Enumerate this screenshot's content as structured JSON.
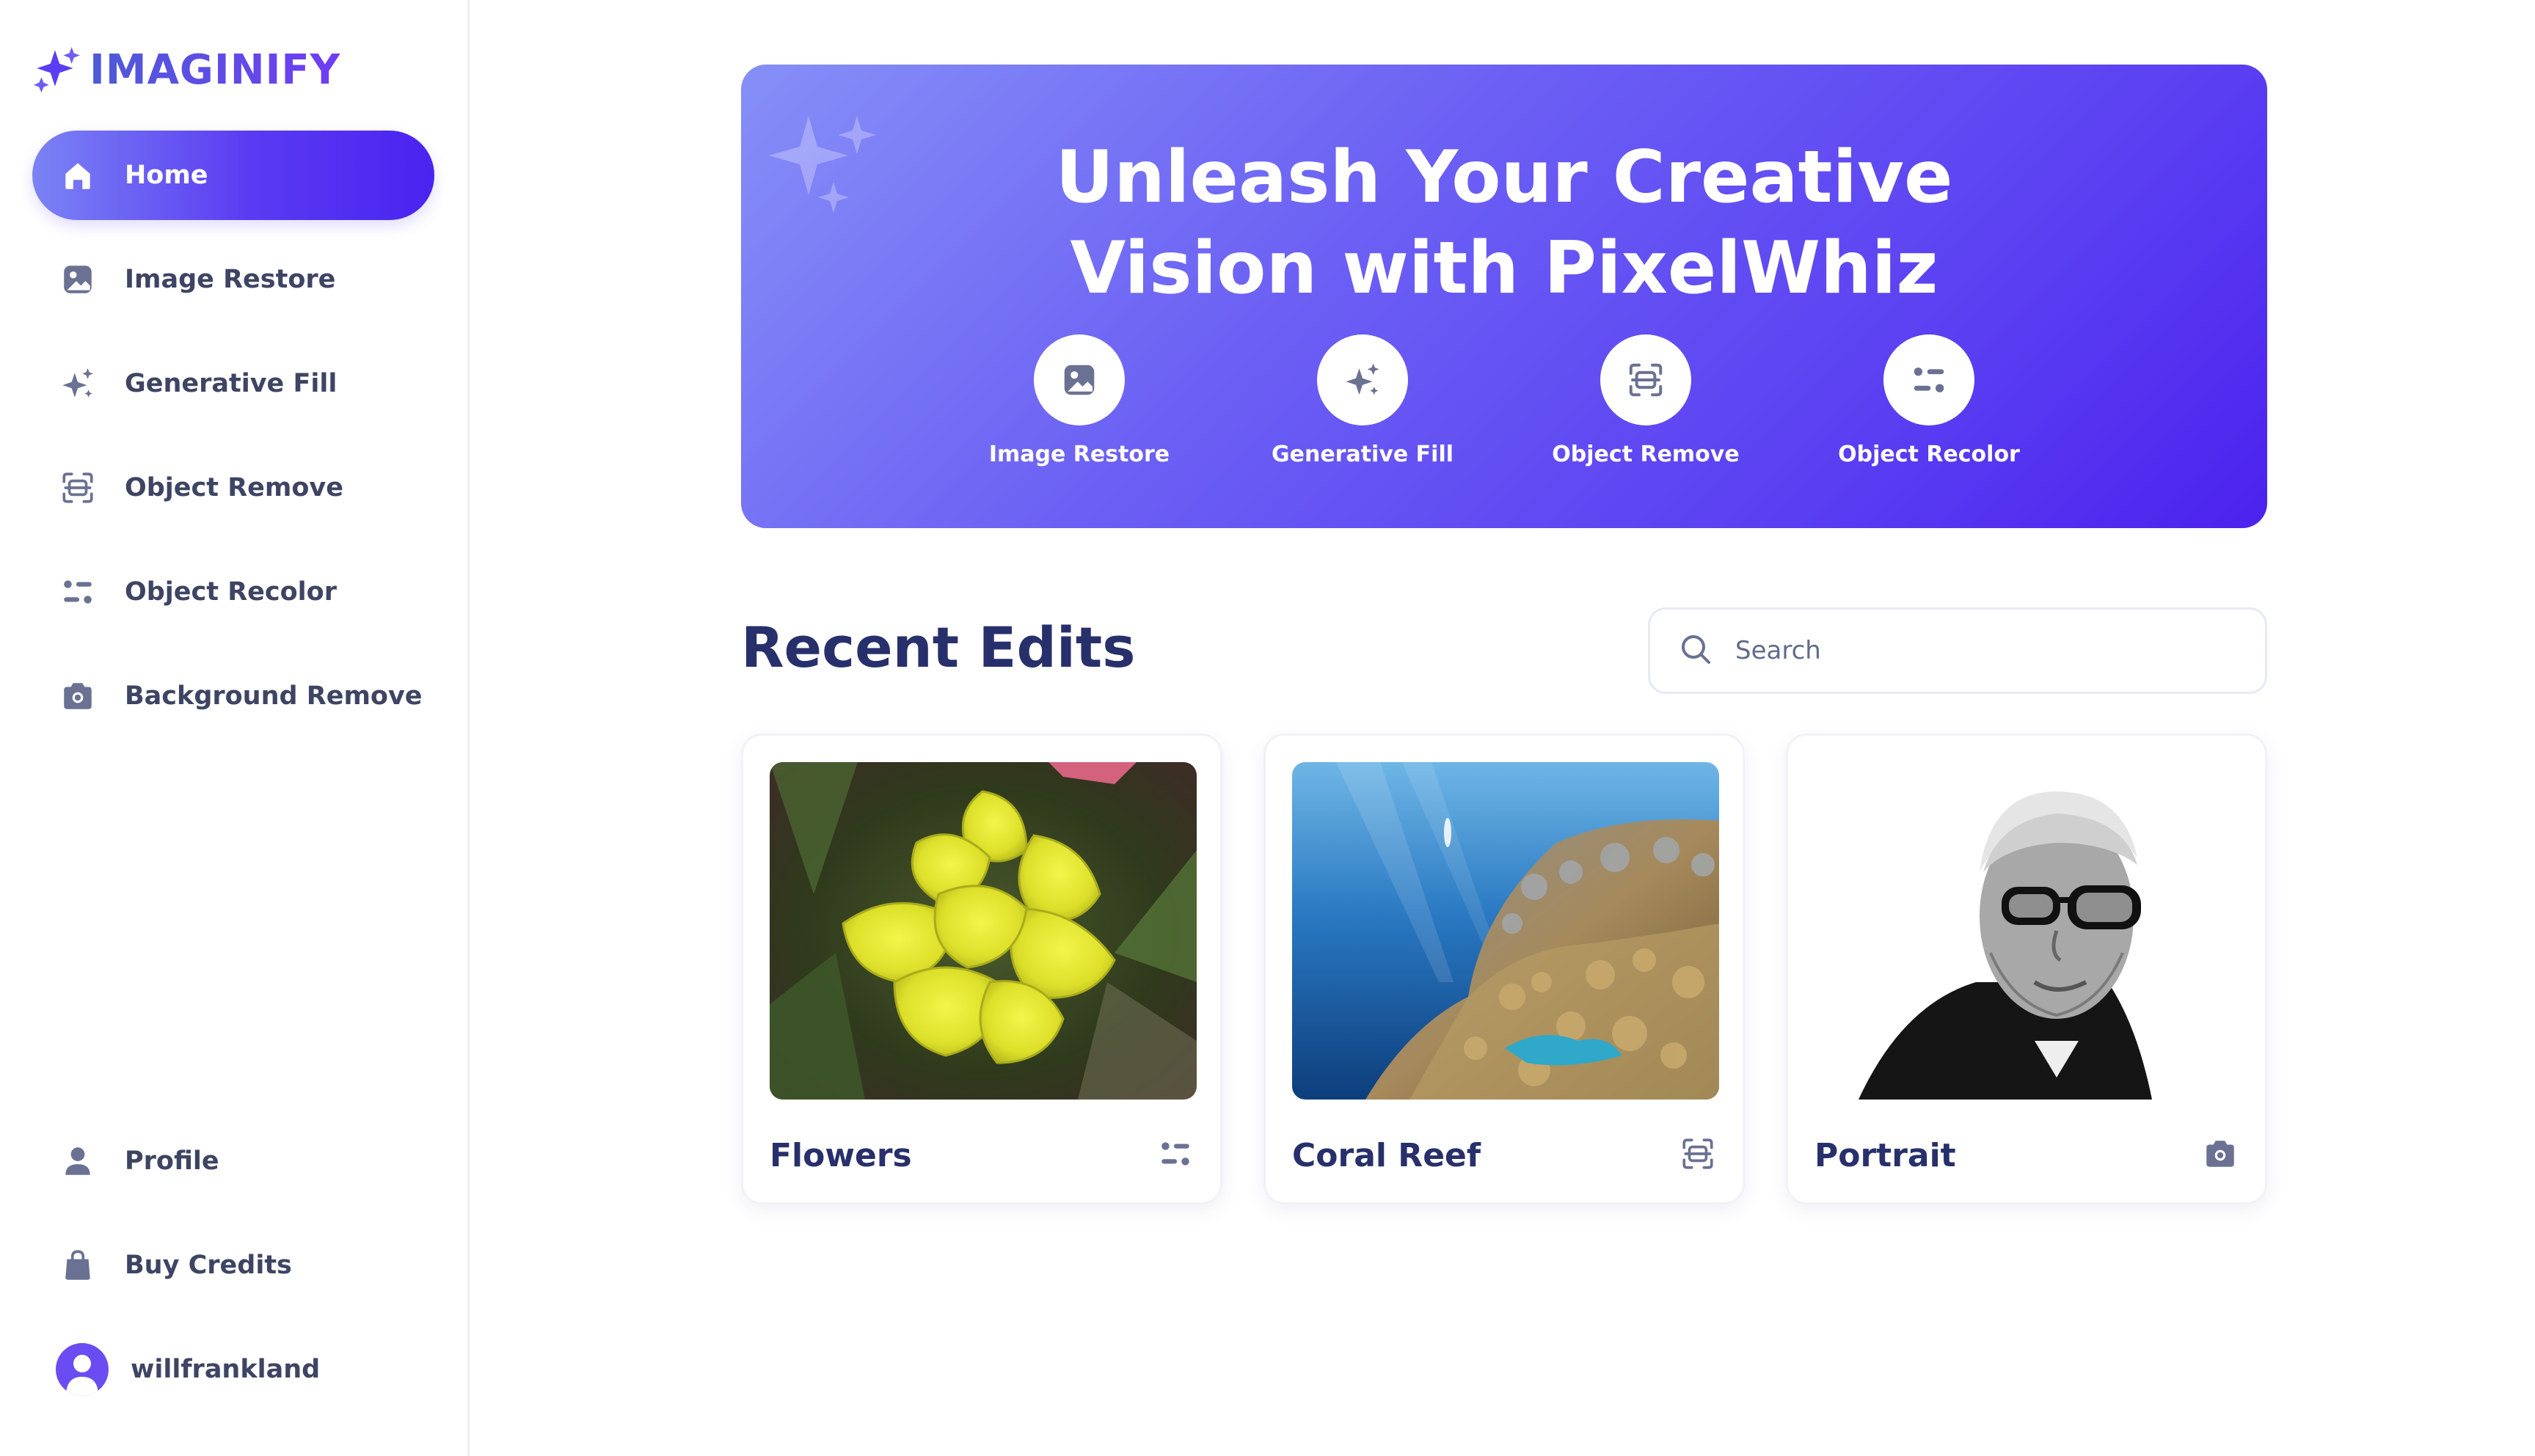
{
  "app": {
    "name": "IMAGINIFY",
    "logo_icon": "sparkles-icon",
    "accent_color": "#5b3ef2"
  },
  "sidebar": {
    "items": [
      {
        "label": "Home",
        "icon": "home-icon",
        "active": true
      },
      {
        "label": "Image Restore",
        "icon": "image-icon"
      },
      {
        "label": "Generative Fill",
        "icon": "sparkles-icon"
      },
      {
        "label": "Object Remove",
        "icon": "scan-icon"
      },
      {
        "label": "Object Recolor",
        "icon": "filter-icon"
      },
      {
        "label": "Background Remove",
        "icon": "camera-icon"
      }
    ],
    "bottom_items": [
      {
        "label": "Profile",
        "icon": "profile-icon"
      },
      {
        "label": "Buy Credits",
        "icon": "bag-icon"
      }
    ],
    "user": {
      "name": "willfrankland",
      "icon": "avatar-icon"
    }
  },
  "banner": {
    "title_line1": "Unleash Your Creative",
    "title_line2": "Vision with PixelWhiz",
    "actions": [
      {
        "label": "Image Restore",
        "icon": "image-icon"
      },
      {
        "label": "Generative Fill",
        "icon": "sparkles-icon"
      },
      {
        "label": "Object Remove",
        "icon": "scan-icon"
      },
      {
        "label": "Object Recolor",
        "icon": "filter-icon"
      }
    ]
  },
  "recent": {
    "title": "Recent Edits",
    "search_placeholder": "Search",
    "search_value": "",
    "cards": [
      {
        "title": "Flowers",
        "icon": "filter-icon"
      },
      {
        "title": "Coral Reef",
        "icon": "scan-icon"
      },
      {
        "title": "Portrait",
        "icon": "camera-icon"
      }
    ]
  }
}
